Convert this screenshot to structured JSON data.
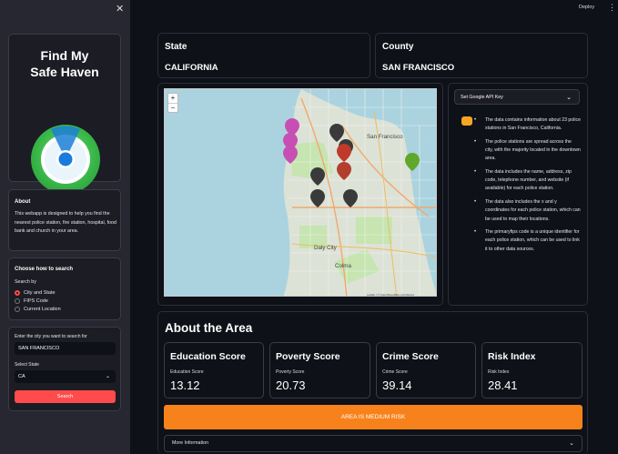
{
  "topbar": {
    "deploy_label": "Deploy",
    "menu_icon": "kebab-icon"
  },
  "sidebar": {
    "close_icon": "close-icon",
    "title": "Find My Safe Haven",
    "about": {
      "heading": "About",
      "text": "This webapp is designed to help you find the nearest police station, fire station, hospital, food bank and church in your area."
    },
    "search_method": {
      "heading": "Choose how to search",
      "label": "Search by",
      "options": [
        "City and State",
        "FIPS Code",
        "Current Location"
      ],
      "selected": "City and State"
    },
    "search_form": {
      "city_label": "Enter the city you want to search for",
      "city_value": "SAN FRANCISCO",
      "state_label": "Select State",
      "state_value": "CA",
      "search_button": "Search"
    }
  },
  "location": {
    "state_label": "State",
    "state_value": "CALIFORNIA",
    "county_label": "County",
    "county_value": "SAN FRANCISCO"
  },
  "map": {
    "labels": [
      "San Francisco",
      "Daly City",
      "Colma"
    ],
    "zoom_in": "+",
    "zoom_out": "−",
    "attribution": "Leaflet | © OpenStreetMap contributors"
  },
  "ai_panel": {
    "dropdown_label": "Set Google API Key",
    "bullets": [
      "The data contains information about 23 police stations in San Francisco, California.",
      "The police stations are spread across the city, with the majority located in the downtown area.",
      "The data includes the name, address, zip code, telephone number, and website (if available) for each police station.",
      "The data also includes the x and y coordinates for each police station, which can be used to map their locations.",
      "The primaryfips code is a unique identifier for each police station, which can be used to link it to other data sources."
    ]
  },
  "area": {
    "title": "About the Area",
    "metrics": [
      {
        "title": "Education Score",
        "label": "Education Score",
        "value": "13.12"
      },
      {
        "title": "Poverty Score",
        "label": "Poverty Score",
        "value": "20.73"
      },
      {
        "title": "Crime Score",
        "label": "Crime Score",
        "value": "39.14"
      },
      {
        "title": "Risk Index",
        "label": "Risk Index",
        "value": "28.41"
      }
    ],
    "risk_banner": "AREA IS MEDIUM RISK",
    "more_info": "More Information"
  },
  "colors": {
    "accent": "#ff4b4b",
    "risk": "#f7821b",
    "background": "#0e1117",
    "sidebar": "#262730"
  }
}
